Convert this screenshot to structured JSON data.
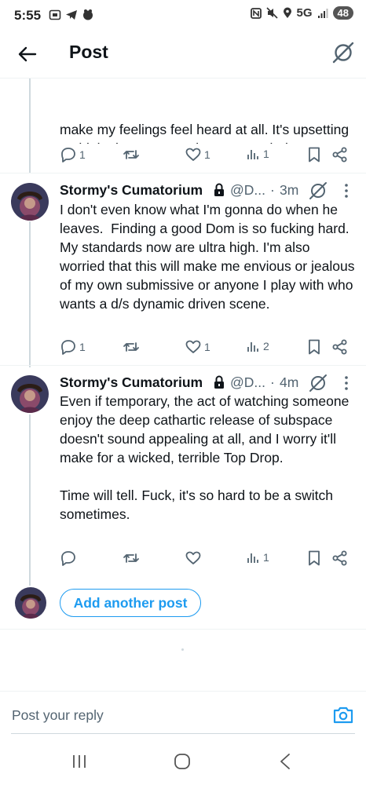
{
  "status_bar": {
    "time": "5:55",
    "network": "5G",
    "battery": "48"
  },
  "header": {
    "title": "Post"
  },
  "colors": {
    "accent": "#1d9bf0",
    "text": "#0f1419",
    "secondary": "#536471"
  },
  "icons": [
    "back-arrow-icon",
    "grok-icon",
    "reply-icon",
    "retweet-icon",
    "like-icon",
    "views-icon",
    "bookmark-icon",
    "share-icon",
    "lock-icon",
    "more-icon",
    "camera-icon"
  ],
  "tweets": [
    {
      "text": "make my feelings feel heard at all. It's upsetting to think about my needs, not even being considered.",
      "replies": "1",
      "retweets": "",
      "likes": "1",
      "views": "1"
    },
    {
      "name": "Stormy's Cumatorium",
      "handle": "@D...",
      "dot": "·",
      "time": "3m",
      "text": "I don't even know what I'm gonna do when he leaves.  Finding a good Dom is so fucking hard. My standards now are ultra high. I'm also worried that this will make me envious or jealous of my own submissive or anyone I play with who wants a d/s dynamic driven scene.",
      "replies": "1",
      "retweets": "",
      "likes": "1",
      "views": "2"
    },
    {
      "name": "Stormy's Cumatorium",
      "handle": "@D...",
      "dot": "·",
      "time": "4m",
      "text": "Even if temporary, the act of watching someone enjoy the deep cathartic release of subspace doesn't sound appealing at all, and I worry it'll make for a wicked, terrible Top Drop.\n\nTime will tell. Fuck, it's so hard to be a switch sometimes.",
      "replies": "",
      "retweets": "",
      "likes": "",
      "views": "1"
    }
  ],
  "add_post": {
    "label": "Add another post"
  },
  "reply": {
    "placeholder": "Post your reply"
  }
}
